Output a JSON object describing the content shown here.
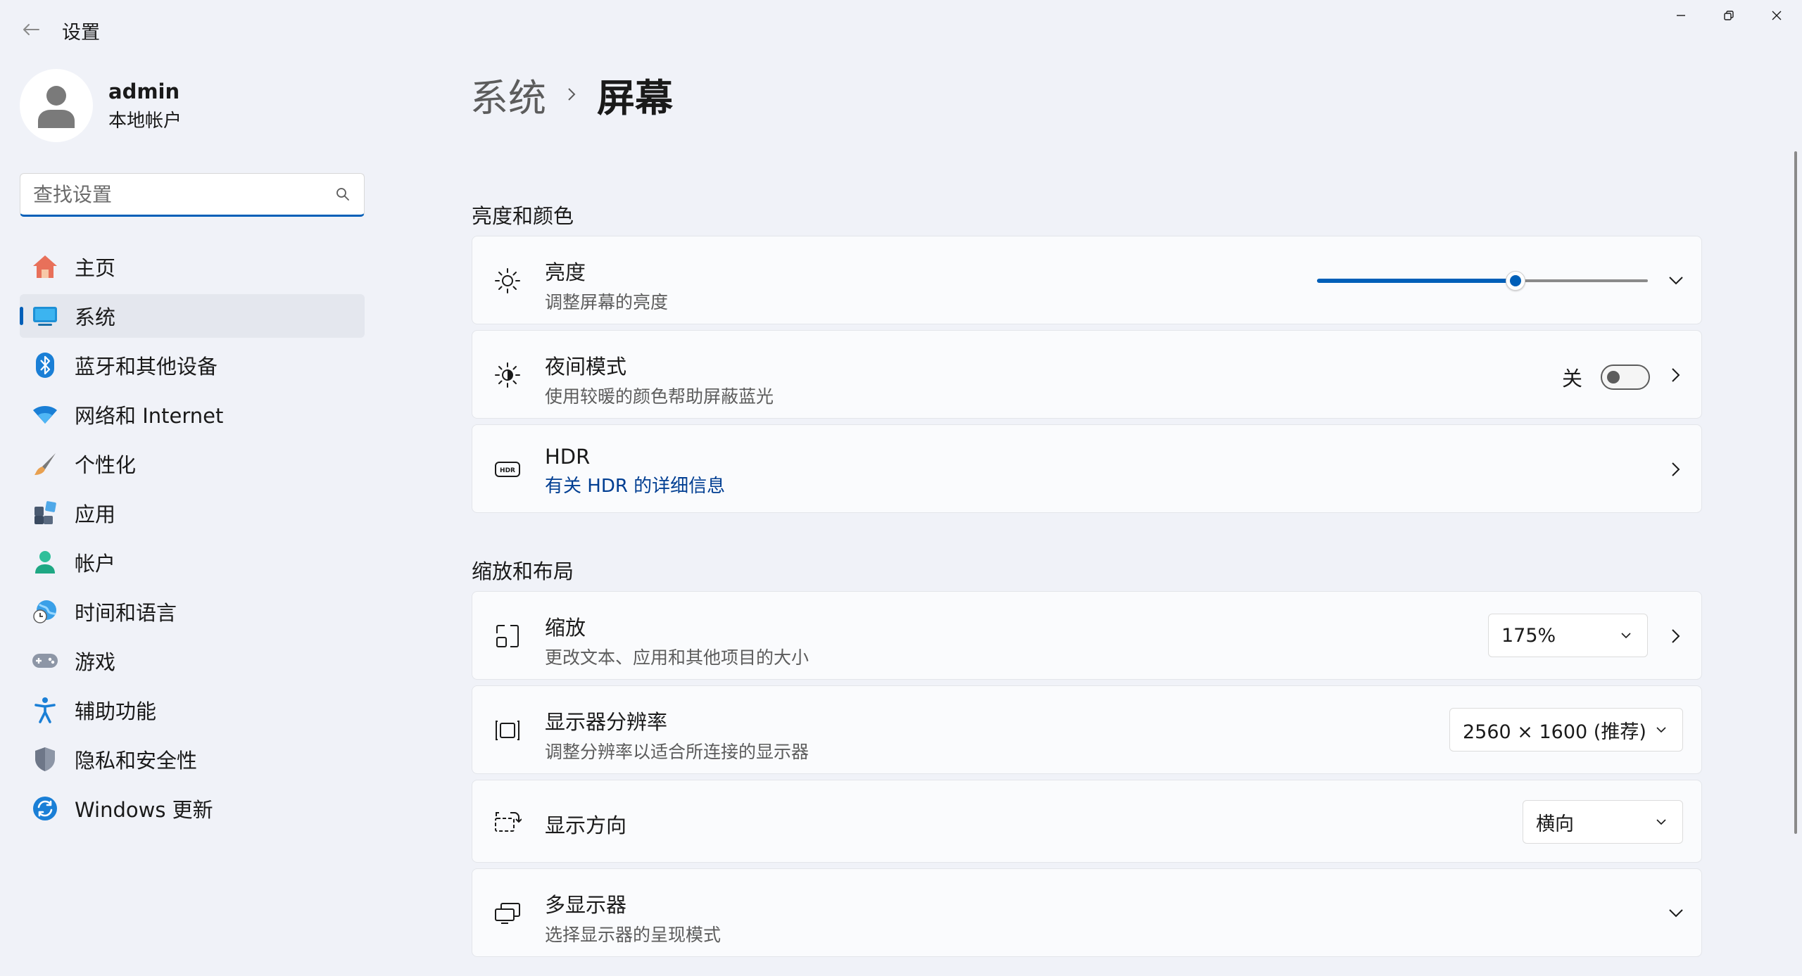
{
  "window": {
    "title": "设置"
  },
  "profile": {
    "name": "admin",
    "account_type": "本地帐户"
  },
  "search": {
    "placeholder": "查找设置"
  },
  "sidebar": {
    "items": [
      {
        "label": "主页",
        "icon": "home-icon"
      },
      {
        "label": "系统",
        "icon": "system-icon",
        "active": true
      },
      {
        "label": "蓝牙和其他设备",
        "icon": "bluetooth-icon"
      },
      {
        "label": "网络和 Internet",
        "icon": "wifi-icon"
      },
      {
        "label": "个性化",
        "icon": "brush-icon"
      },
      {
        "label": "应用",
        "icon": "apps-icon"
      },
      {
        "label": "帐户",
        "icon": "account-icon"
      },
      {
        "label": "时间和语言",
        "icon": "globe-clock-icon"
      },
      {
        "label": "游戏",
        "icon": "gamepad-icon"
      },
      {
        "label": "辅助功能",
        "icon": "accessibility-icon"
      },
      {
        "label": "隐私和安全性",
        "icon": "shield-icon"
      },
      {
        "label": "Windows 更新",
        "icon": "update-icon"
      }
    ]
  },
  "breadcrumb": {
    "parent": "系统",
    "current": "屏幕"
  },
  "sections": {
    "brightness_color": {
      "title": "亮度和颜色",
      "brightness": {
        "title": "亮度",
        "subtitle": "调整屏幕的亮度",
        "value_percent": 60
      },
      "night_light": {
        "title": "夜间模式",
        "subtitle": "使用较暖的颜色帮助屏蔽蓝光",
        "state_label": "关",
        "on": false
      },
      "hdr": {
        "title": "HDR",
        "link": "有关 HDR 的详细信息"
      }
    },
    "scale_layout": {
      "title": "缩放和布局",
      "scale": {
        "title": "缩放",
        "subtitle": "更改文本、应用和其他项目的大小",
        "value": "175%"
      },
      "resolution": {
        "title": "显示器分辨率",
        "subtitle": "调整分辨率以适合所连接的显示器",
        "value": "2560 × 1600 (推荐)"
      },
      "orientation": {
        "title": "显示方向",
        "value": "横向"
      },
      "multiple_displays": {
        "title": "多显示器",
        "subtitle": "选择显示器的呈现模式"
      }
    }
  },
  "colors": {
    "accent": "#005fb8",
    "background": "#f0f2f8",
    "card": "#fafbfd"
  }
}
